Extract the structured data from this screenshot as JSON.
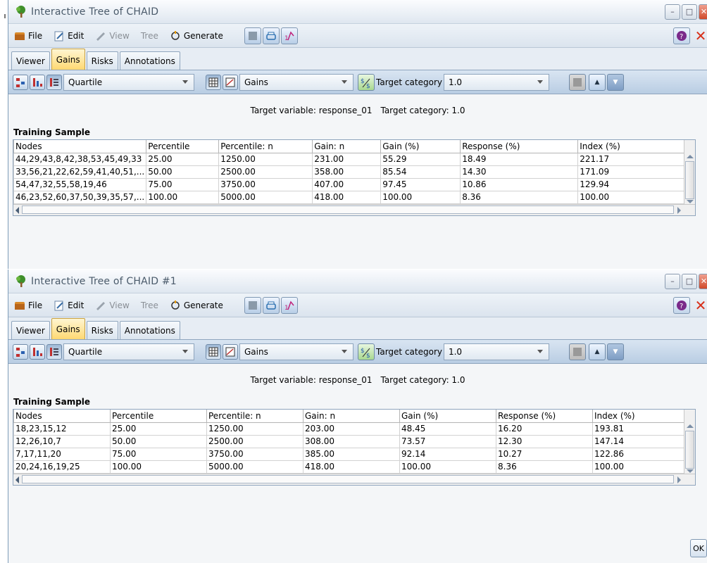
{
  "windows": [
    {
      "title": "Interactive Tree of CHAID",
      "menu": {
        "file": "File",
        "edit": "Edit",
        "view": "View",
        "tree": "Tree",
        "generate": "Generate"
      },
      "tabs": [
        "Viewer",
        "Gains",
        "Risks",
        "Annotations"
      ],
      "active_tab": "Gains",
      "toolbar": {
        "quantile": "Quartile",
        "table_mode": "Gains",
        "target_category_label": "Target category",
        "target_category_value": "1.0"
      },
      "target_line": {
        "variable": "Target variable: response_01",
        "category": "Target category: 1.0"
      },
      "section_label": "Training Sample",
      "columns": [
        "Nodes",
        "Percentile",
        "Percentile: n",
        "Gain: n",
        "Gain (%)",
        "Response (%)",
        "Index (%)"
      ],
      "rows": [
        [
          "44,29,43,8,42,38,53,45,49,33",
          "25.00",
          "1250.00",
          "231.00",
          "55.29",
          "18.49",
          "221.17"
        ],
        [
          "33,56,21,22,62,59,41,40,51,...",
          "50.00",
          "2500.00",
          "358.00",
          "85.54",
          "14.30",
          "171.09"
        ],
        [
          "54,47,32,55,58,19,46",
          "75.00",
          "3750.00",
          "407.00",
          "97.45",
          "10.86",
          "129.94"
        ],
        [
          "46,23,52,60,37,50,39,35,57,...",
          "100.00",
          "5000.00",
          "418.00",
          "100.00",
          "8.36",
          "100.00"
        ]
      ]
    },
    {
      "title": "Interactive Tree of CHAID #1",
      "menu": {
        "file": "File",
        "edit": "Edit",
        "view": "View",
        "tree": "Tree",
        "generate": "Generate"
      },
      "tabs": [
        "Viewer",
        "Gains",
        "Risks",
        "Annotations"
      ],
      "active_tab": "Gains",
      "toolbar": {
        "quantile": "Quartile",
        "table_mode": "Gains",
        "target_category_label": "Target category",
        "target_category_value": "1.0"
      },
      "target_line": {
        "variable": "Target variable: response_01",
        "category": "Target category: 1.0"
      },
      "section_label": "Training Sample",
      "columns": [
        "Nodes",
        "Percentile",
        "Percentile: n",
        "Gain: n",
        "Gain (%)",
        "Response (%)",
        "Index (%)"
      ],
      "rows": [
        [
          "18,23,15,12",
          "25.00",
          "1250.00",
          "203.00",
          "48.45",
          "16.20",
          "193.81"
        ],
        [
          "12,26,10,7",
          "50.00",
          "2500.00",
          "308.00",
          "73.57",
          "12.30",
          "147.14"
        ],
        [
          "7,17,11,20",
          "75.00",
          "3750.00",
          "385.00",
          "92.14",
          "10.27",
          "122.86"
        ],
        [
          "20,24,16,19,25",
          "100.00",
          "5000.00",
          "418.00",
          "100.00",
          "8.36",
          "100.00"
        ]
      ]
    }
  ],
  "ok_label": "OK",
  "colors": {
    "active_tab": "#ffd872",
    "toolbar_bg": "#c7d8ea",
    "close_red": "#d8301a"
  }
}
